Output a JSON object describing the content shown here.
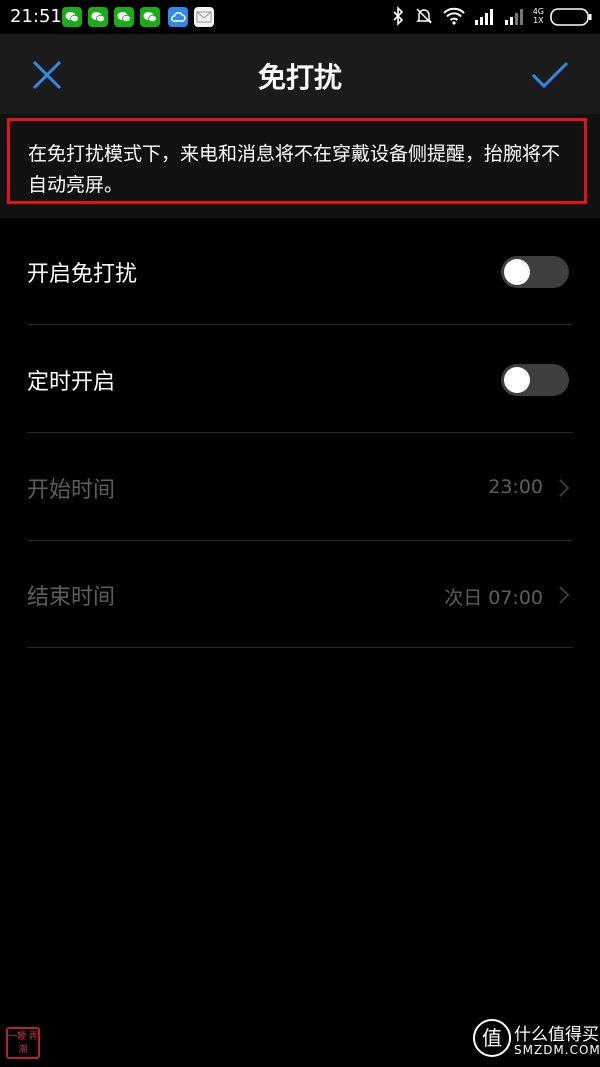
{
  "status_bar": {
    "time": "21:51",
    "notifications": [
      "wechat-icon",
      "wechat-icon",
      "wechat-icon",
      "wechat-icon",
      "cloud-icon",
      "mail-icon"
    ],
    "network_type": "4G",
    "sim_label": "1X",
    "icons": [
      "bluetooth-icon",
      "mute-bell-icon",
      "wifi-icon",
      "signal-icon",
      "signal-icon",
      "battery-icon"
    ]
  },
  "header": {
    "title": "免打扰",
    "close_icon": "close-icon",
    "confirm_icon": "check-icon"
  },
  "notice": {
    "text": "在免打扰模式下，来电和消息将不在穿戴设备侧提醒，抬腕将不自动亮屏。"
  },
  "settings": {
    "enable_dnd": {
      "label": "开启免打扰",
      "on": false
    },
    "scheduled": {
      "label": "定时开启",
      "on": false
    },
    "start_time": {
      "label": "开始时间",
      "value": "23:00"
    },
    "end_time": {
      "label": "结束时间",
      "value": "次日 07:00"
    }
  },
  "watermark": {
    "seal_text": "一鞭 弄潮",
    "brand_cn": "什么值得买",
    "brand_en": "SMZDM.COM",
    "logo_char": "值"
  },
  "colors": {
    "accent": "#2f8be6",
    "highlight_border": "#e0141a",
    "background": "#000000",
    "header_bg": "#1b1b1b",
    "disabled_text": "#5e5e5e"
  }
}
